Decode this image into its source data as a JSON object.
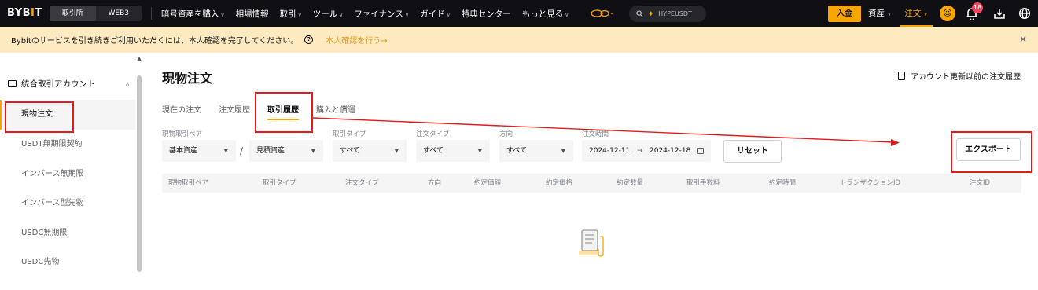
{
  "topbar": {
    "logo": "BYBIT",
    "segments": [
      "取引所",
      "WEB3"
    ],
    "nav": [
      "暗号資産を購入",
      "相場情報",
      "取引",
      "ツール",
      "ファイナンス",
      "ガイド",
      "特典センター",
      "もっと見る"
    ],
    "search_placeholder": "HYPEUSDT",
    "deposit": "入金",
    "assets": "資産",
    "orders": "注文",
    "notification_count": "18"
  },
  "notice": {
    "text": "Bybitのサービスを引き続きご利用いただくには、本人確認を完了してください。",
    "link": "本人確認を行う→"
  },
  "sidebar": {
    "group": "統合取引アカウント",
    "items": [
      "現物注文",
      "USDT無期限契約",
      "インバース無期限",
      "インバース型先物",
      "USDC無期限",
      "USDC先物"
    ]
  },
  "main": {
    "title": "現物注文",
    "history_link": "アカウント更新以前の注文履歴",
    "tabs": [
      "現在の注文",
      "注文履歴",
      "取引履歴",
      "購入と償還"
    ],
    "filters": {
      "pair_label": "現物取引ペア",
      "base": "基本資産",
      "quote": "見積資産",
      "trade_type_label": "取引タイプ",
      "trade_type": "すべて",
      "order_type_label": "注文タイプ",
      "order_type": "すべて",
      "direction_label": "方向",
      "direction": "すべて",
      "time_label": "注文時間",
      "date_from": "2024-12-11",
      "date_to": "2024-12-18",
      "reset": "リセット",
      "export": "エクスポート"
    },
    "columns": [
      "現物取引ペア",
      "取引タイプ",
      "注文タイプ",
      "方向",
      "約定価額",
      "約定価格",
      "約定数量",
      "取引手数料",
      "約定時間",
      "トランザクションID",
      "注文ID"
    ]
  },
  "colors": {
    "accent": "#f7a600",
    "topbar_bg": "#101014",
    "notice_bg": "#fdeac1",
    "annotation": "#e31b1b"
  }
}
